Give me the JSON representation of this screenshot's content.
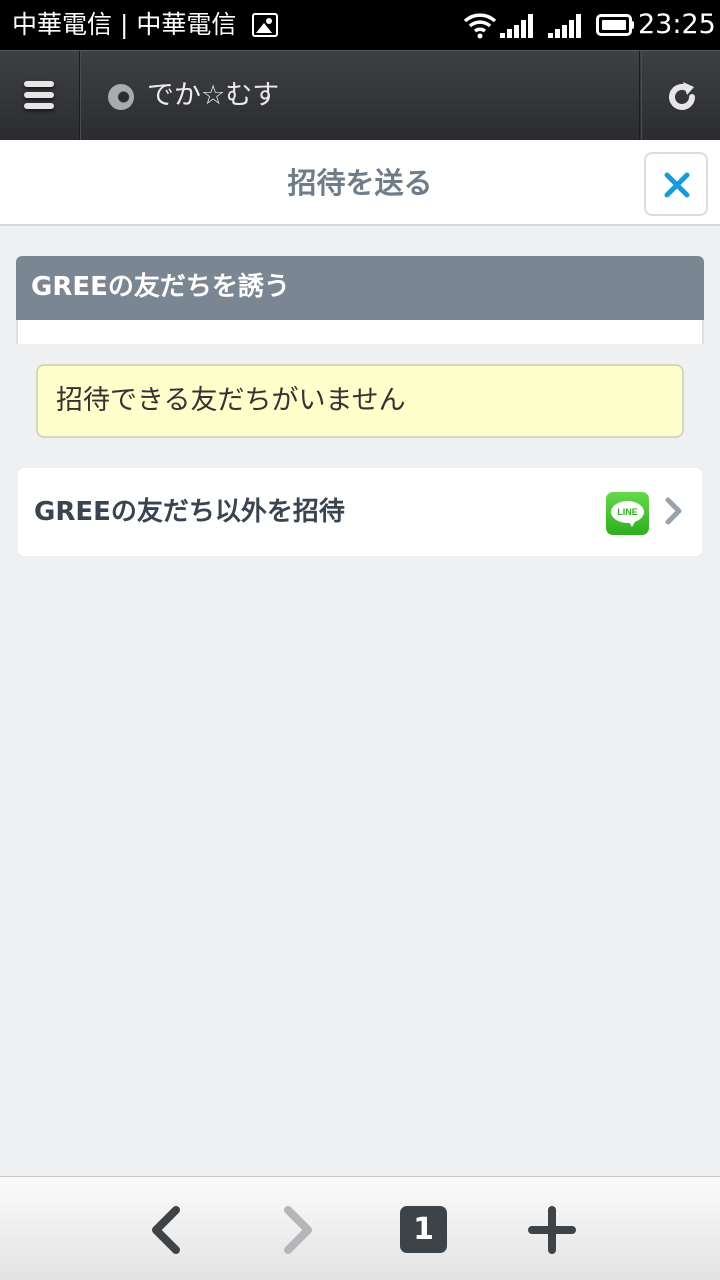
{
  "status_bar": {
    "carrier": "中華電信 | 中華電信",
    "time": "23:25",
    "icons": [
      "image-notification-icon",
      "wifi-icon",
      "signal-icon",
      "signal-icon",
      "battery-icon"
    ]
  },
  "browser": {
    "page_title": "でか☆むす",
    "icons": {
      "menu": "menu-icon",
      "site": "site-favicon",
      "reload": "reload-icon"
    }
  },
  "dialog": {
    "title": "招待を送る",
    "close_icon": "close-icon"
  },
  "section": {
    "title": "GREEの友だちを誘う",
    "notice": "招待できる友だちがいません"
  },
  "invite_others": {
    "label": "GREEの友だち以外を招待",
    "line_logo_text": "LINE"
  },
  "bottom_nav": {
    "tab_count": "1",
    "icons": [
      "back-icon",
      "forward-icon",
      "tabs-icon",
      "new-tab-icon"
    ]
  },
  "colors": {
    "status_bar": "#000000",
    "toolbar": "#2f3134",
    "page_bg": "#eff0f2",
    "section_header": "#7a8692",
    "notice_bg": "#ffffcc",
    "accent": "#1a9bd7",
    "line_green": "#3cc22a"
  }
}
